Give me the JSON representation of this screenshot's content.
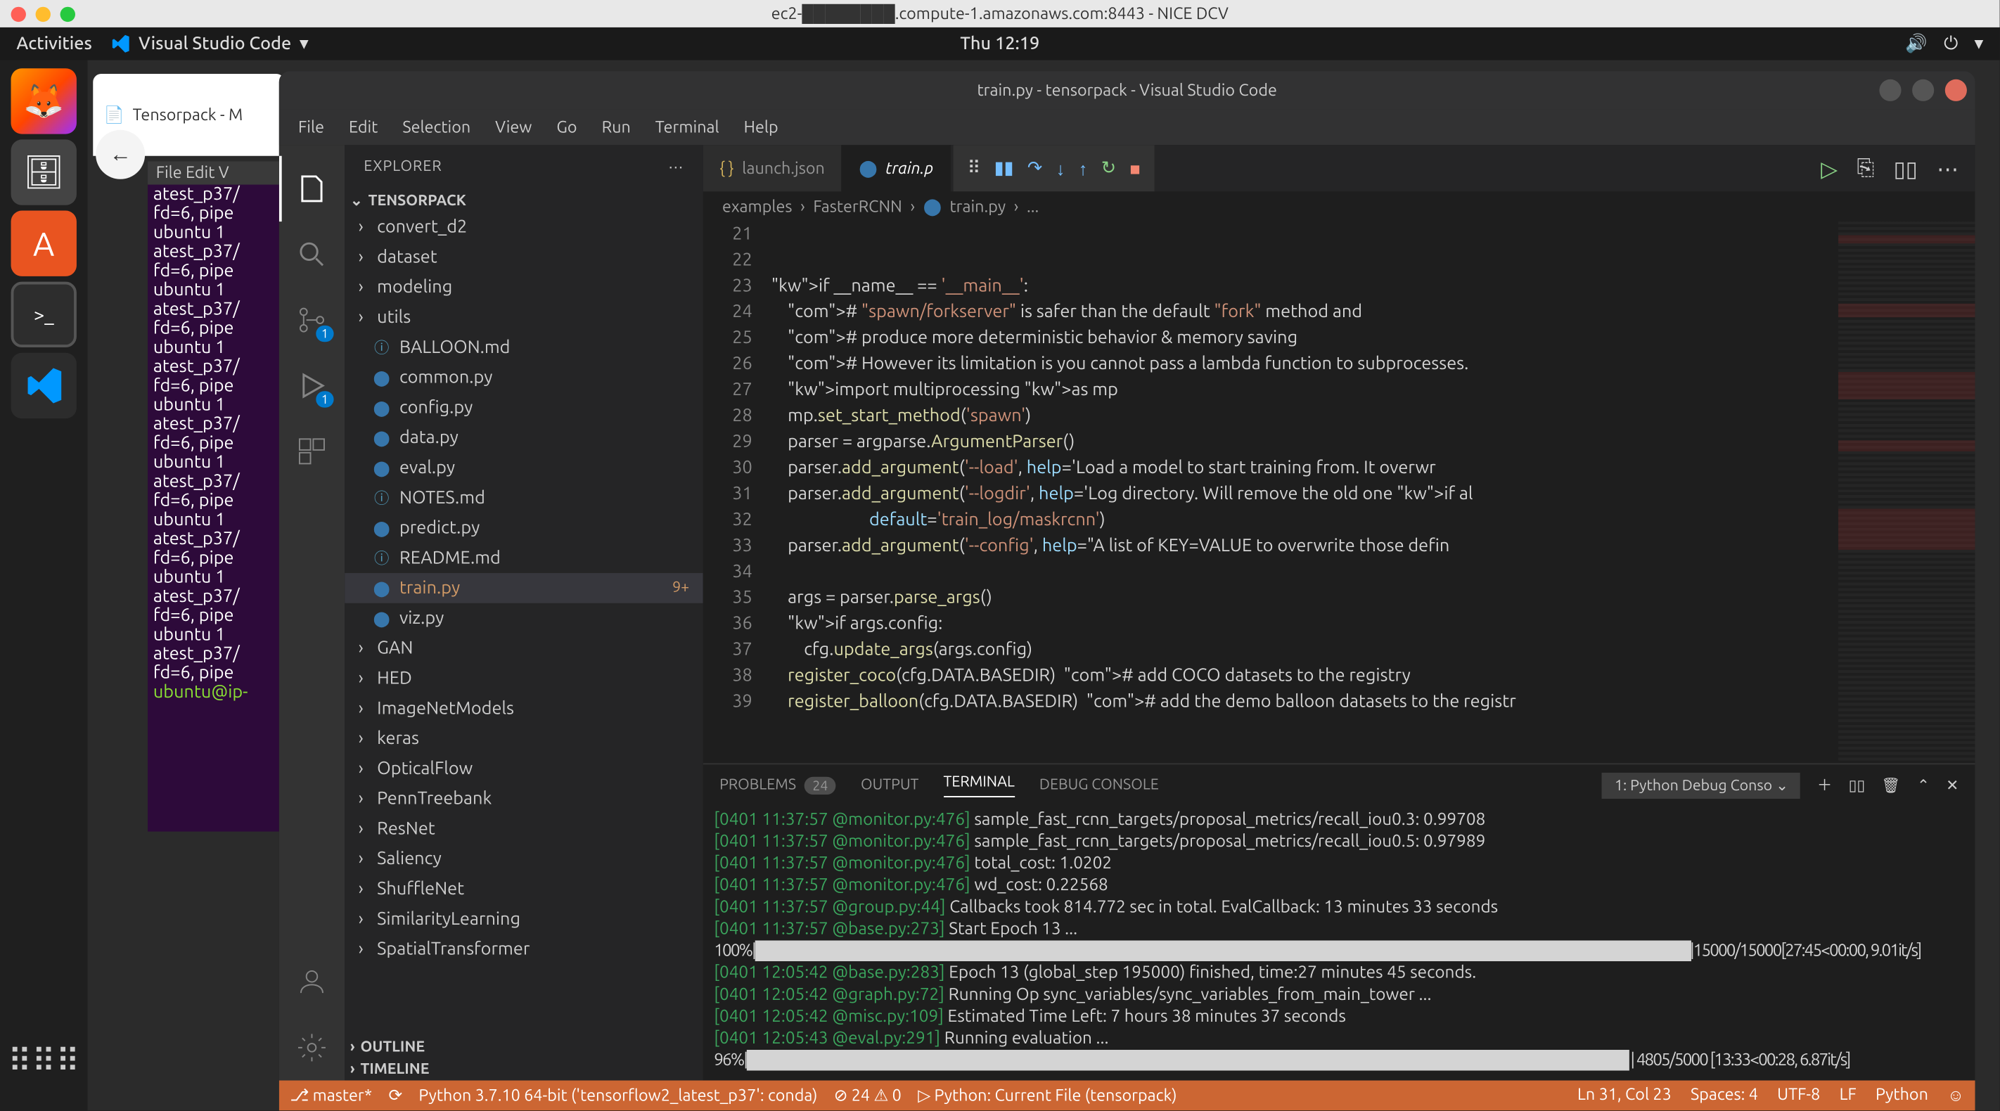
{
  "mac": {
    "title": "ec2-████████.compute-1.amazonaws.com:8443 - NICE DCV"
  },
  "gnome": {
    "activities": "Activities",
    "app": "Visual Studio Code",
    "clock": "Thu 12:19"
  },
  "browser_tab": "Tensorpack - M",
  "gedit": {
    "menu": "File  Edit  V",
    "lines": [
      "atest_p37/",
      "fd=6, pipe",
      "ubuntu    1",
      "atest_p37/",
      "fd=6, pipe",
      "ubuntu    1",
      "atest_p37/",
      "fd=6, pipe",
      "ubuntu    1",
      "atest_p37/",
      "fd=6, pipe",
      "ubuntu    1",
      "atest_p37/",
      "fd=6, pipe",
      "ubuntu    1",
      "atest_p37/",
      "fd=6, pipe",
      "ubuntu    1",
      "atest_p37/",
      "fd=6, pipe",
      "ubuntu    1",
      "atest_p37/",
      "fd=6, pipe",
      "ubuntu    1",
      "atest_p37/",
      "fd=6, pipe"
    ],
    "prompt": "ubuntu@ip-"
  },
  "vscode": {
    "title": "train.py - tensorpack - Visual Studio Code",
    "menu": [
      "File",
      "Edit",
      "Selection",
      "View",
      "Go",
      "Run",
      "Terminal",
      "Help"
    ],
    "activity_badges": {
      "scm": "1",
      "debug": "1"
    },
    "sidebar": {
      "title": "EXPLORER",
      "root": "TENSORPACK",
      "items": [
        {
          "t": "folder",
          "label": "convert_d2"
        },
        {
          "t": "folder",
          "label": "dataset"
        },
        {
          "t": "folder",
          "label": "modeling"
        },
        {
          "t": "folder",
          "label": "utils"
        },
        {
          "t": "file",
          "label": "BALLOON.md",
          "icon": "md"
        },
        {
          "t": "file",
          "label": "common.py",
          "icon": "py"
        },
        {
          "t": "file",
          "label": "config.py",
          "icon": "py"
        },
        {
          "t": "file",
          "label": "data.py",
          "icon": "py"
        },
        {
          "t": "file",
          "label": "eval.py",
          "icon": "py"
        },
        {
          "t": "file",
          "label": "NOTES.md",
          "icon": "md"
        },
        {
          "t": "file",
          "label": "predict.py",
          "icon": "py"
        },
        {
          "t": "file",
          "label": "README.md",
          "icon": "md"
        },
        {
          "t": "file",
          "label": "train.py",
          "icon": "py",
          "selected": true,
          "badge": "9+"
        },
        {
          "t": "file",
          "label": "viz.py",
          "icon": "py"
        },
        {
          "t": "folder",
          "label": "GAN"
        },
        {
          "t": "folder",
          "label": "HED"
        },
        {
          "t": "folder",
          "label": "ImageNetModels"
        },
        {
          "t": "folder",
          "label": "keras"
        },
        {
          "t": "folder",
          "label": "OpticalFlow"
        },
        {
          "t": "folder",
          "label": "PennTreebank"
        },
        {
          "t": "folder",
          "label": "ResNet"
        },
        {
          "t": "folder",
          "label": "Saliency"
        },
        {
          "t": "folder",
          "label": "ShuffleNet"
        },
        {
          "t": "folder",
          "label": "SimilarityLearning"
        },
        {
          "t": "folder",
          "label": "SpatialTransformer"
        }
      ],
      "outline": "OUTLINE",
      "timeline": "TIMELINE"
    },
    "tabs": [
      {
        "label": "launch.json",
        "icon": "{}",
        "active": false
      },
      {
        "label": "train.p",
        "icon": "py",
        "active": true
      }
    ],
    "breadcrumb": [
      "examples",
      "FasterRCNN",
      "train.py",
      "..."
    ],
    "gutter_start": 21,
    "code_lines": [
      "",
      "",
      "if __name__ == '__main__':",
      "    # \"spawn/forkserver\" is safer than the default \"fork\" method and",
      "    # produce more deterministic behavior & memory saving",
      "    # However its limitation is you cannot pass a lambda function to subprocesses.",
      "    import multiprocessing as mp",
      "    mp.set_start_method('spawn')",
      "    parser = argparse.ArgumentParser()",
      "    parser.add_argument('--load', help='Load a model to start training from. It overwr",
      "    parser.add_argument('--logdir', help='Log directory. Will remove the old one if al",
      "                        default='train_log/maskrcnn')",
      "    parser.add_argument('--config', help=\"A list of KEY=VALUE to overwrite those defin",
      "",
      "    args = parser.parse_args()",
      "    if args.config:",
      "        cfg.update_args(args.config)",
      "    register_coco(cfg.DATA.BASEDIR)  # add COCO datasets to the registry",
      "    register_balloon(cfg.DATA.BASEDIR)  # add the demo balloon datasets to the registr"
    ],
    "panel": {
      "tabs": {
        "problems": "PROBLEMS",
        "problems_badge": "24",
        "output": "OUTPUT",
        "terminal": "TERMINAL",
        "debug": "DEBUG CONSOLE"
      },
      "select": "1: Python Debug Conso",
      "lines": [
        {
          "ts": "[0401 11:37:57 @monitor.py:476]",
          "msg": "sample_fast_rcnn_targets/proposal_metrics/recall_iou0.3: 0.99708"
        },
        {
          "ts": "[0401 11:37:57 @monitor.py:476]",
          "msg": "sample_fast_rcnn_targets/proposal_metrics/recall_iou0.5: 0.97989"
        },
        {
          "ts": "[0401 11:37:57 @monitor.py:476]",
          "msg": "total_cost: 1.0202"
        },
        {
          "ts": "[0401 11:37:57 @monitor.py:476]",
          "msg": "wd_cost: 0.22568"
        },
        {
          "ts": "[0401 11:37:57 @group.py:44]",
          "msg": "Callbacks took 814.772 sec in total. EvalCallback: 13 minutes 33 seconds"
        },
        {
          "ts": "[0401 11:37:57 @base.py:273]",
          "msg": "Start Epoch 13 ..."
        }
      ],
      "progress1": "100%|███████████████████████████████████████████████████████████████████████████████████████|15000/15000[27:45<00:00, 9.01it/s]",
      "lines2": [
        {
          "ts": "[0401 12:05:42 @base.py:283]",
          "msg": "Epoch 13 (global_step 195000) finished, time:27 minutes 45 seconds."
        },
        {
          "ts": "[0401 12:05:42 @graph.py:72]",
          "msg": "Running Op sync_variables/sync_variables_from_main_tower ..."
        },
        {
          "ts": "[0401 12:05:42 @misc.py:109]",
          "msg": "Estimated Time Left: 7 hours 38 minutes 37 seconds"
        },
        {
          "ts": "[0401 12:05:43 @eval.py:291]",
          "msg": "Running evaluation ..."
        }
      ],
      "progress2": " 96%|██████████████████████████████████████████████████████████████████████████████████        | 4805/5000 [13:33<00:28,  6.87it/s]"
    },
    "status": {
      "branch": "master*",
      "python": "Python 3.7.10 64-bit ('tensorflow2_latest_p37': conda)",
      "errors": "24",
      "warnings": "0",
      "debug": "Python: Current File (tensorpack)",
      "cursor": "Ln 31, Col 23",
      "spaces": "Spaces: 4",
      "encoding": "UTF-8",
      "eol": "LF",
      "lang": "Python"
    }
  }
}
